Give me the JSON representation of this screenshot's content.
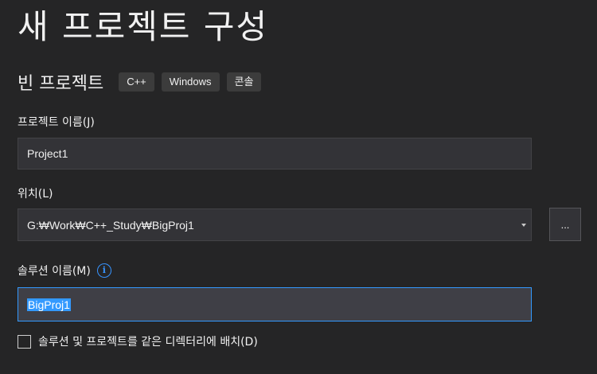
{
  "header": {
    "title": "새 프로젝트 구성"
  },
  "template": {
    "name": "빈 프로젝트",
    "tags": [
      "C++",
      "Windows",
      "콘솔"
    ]
  },
  "project_name": {
    "label": "프로젝트 이름(J)",
    "value": "Project1"
  },
  "location": {
    "label": "위치(L)",
    "value": "G:₩Work₩C++_Study₩BigProj1",
    "browse_label": "..."
  },
  "solution_name": {
    "label": "솔루션 이름(M)",
    "info_glyph": "i",
    "value": "BigProj1"
  },
  "same_directory": {
    "label": "솔루션 및 프로젝트를 같은 디렉터리에 배치(D)",
    "checked": false
  },
  "colors": {
    "background": "#252526",
    "accent": "#3399ff",
    "field": "#333337"
  }
}
